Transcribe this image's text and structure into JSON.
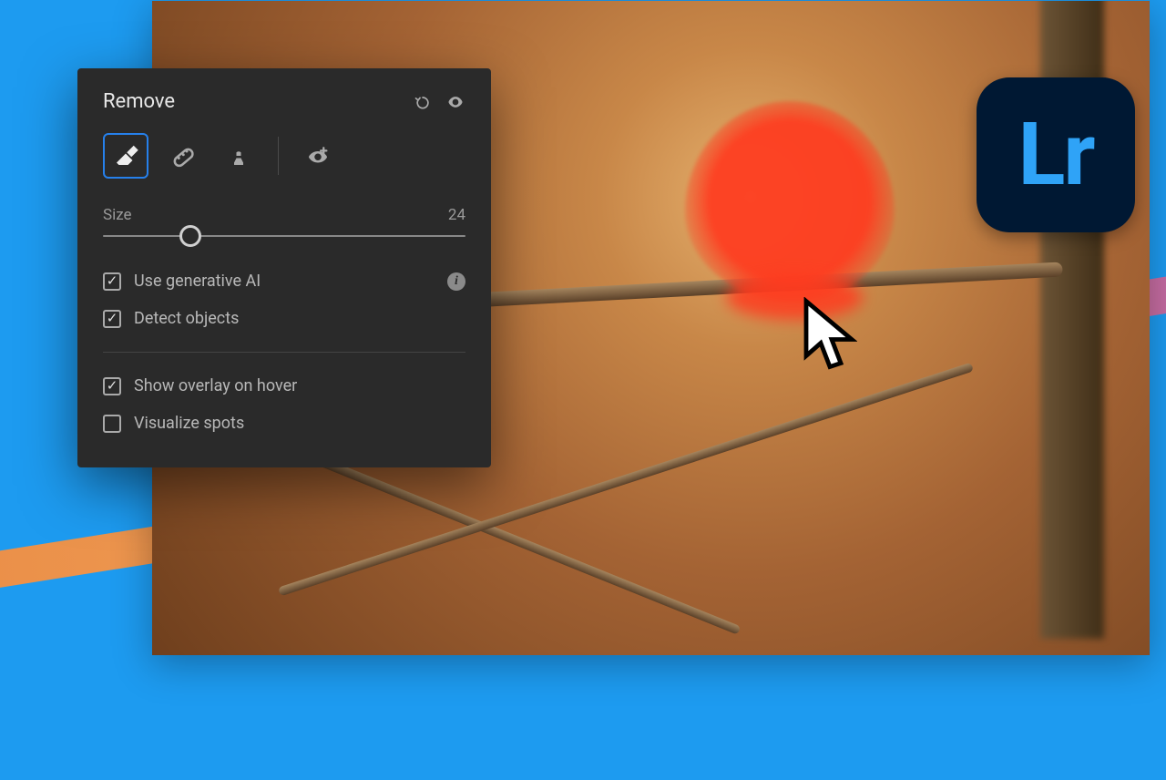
{
  "app": {
    "badge_text": "Lr"
  },
  "panel": {
    "title": "Remove",
    "tools": {
      "eraser": "eraser",
      "heal": "heal",
      "clone": "clone",
      "redeye": "red-eye"
    },
    "slider": {
      "label": "Size",
      "value": "24",
      "percent": 24
    },
    "options": {
      "use_ai": "Use generative AI",
      "detect_objects": "Detect objects",
      "show_overlay": "Show overlay on hover",
      "visualize_spots": "Visualize spots"
    }
  }
}
